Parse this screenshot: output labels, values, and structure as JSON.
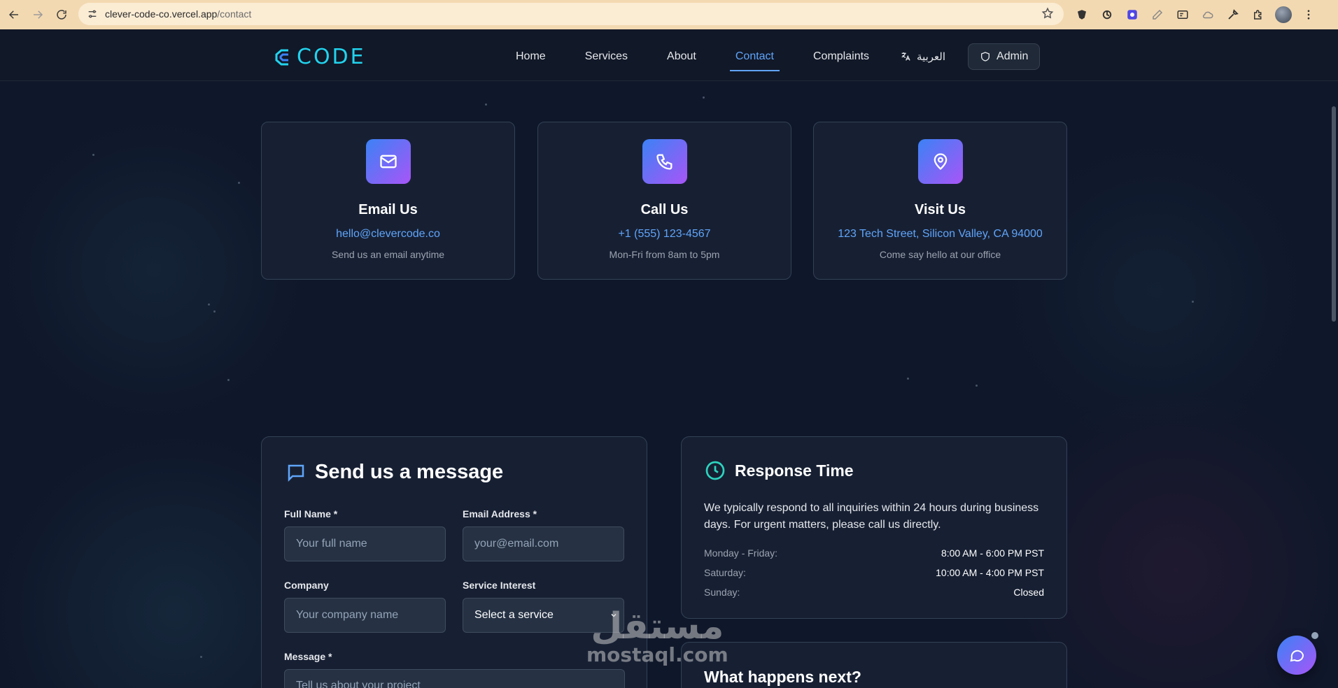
{
  "browser": {
    "url_host": "clever-code-co.vercel.app",
    "url_path": "/contact"
  },
  "header": {
    "logo_text": "CODE",
    "nav": [
      {
        "label": "Home"
      },
      {
        "label": "Services"
      },
      {
        "label": "About"
      },
      {
        "label": "Contact",
        "active": true
      },
      {
        "label": "Complaints"
      }
    ],
    "language_label": "العربية",
    "admin_label": "Admin"
  },
  "contact_cards": [
    {
      "icon": "mail-icon",
      "title": "Email Us",
      "value": "hello@clevercode.co",
      "subtitle": "Send us an email anytime"
    },
    {
      "icon": "phone-icon",
      "title": "Call Us",
      "value": "+1 (555) 123-4567",
      "subtitle": "Mon-Fri from 8am to 5pm"
    },
    {
      "icon": "map-pin-icon",
      "title": "Visit Us",
      "value": "123 Tech Street, Silicon Valley, CA 94000",
      "subtitle": "Come say hello at our office"
    }
  ],
  "form": {
    "title": "Send us a message",
    "full_name": {
      "label": "Full Name *",
      "placeholder": "Your full name"
    },
    "email": {
      "label": "Email Address *",
      "placeholder": "your@email.com"
    },
    "company": {
      "label": "Company",
      "placeholder": "Your company name"
    },
    "service": {
      "label": "Service Interest",
      "selected": "Select a service"
    },
    "message": {
      "label": "Message *",
      "placeholder": "Tell us about your project"
    }
  },
  "response": {
    "title": "Response Time",
    "text": "We typically respond to all inquiries within 24 hours during business days. For urgent matters, please call us directly.",
    "hours": [
      {
        "day": "Monday - Friday:",
        "time": "8:00 AM - 6:00 PM PST"
      },
      {
        "day": "Saturday:",
        "time": "10:00 AM - 4:00 PM PST"
      },
      {
        "day": "Sunday:",
        "time": "Closed"
      }
    ]
  },
  "next": {
    "title": "What happens next?"
  },
  "watermark": {
    "arabic": "مستقل",
    "latin": "mostaql.com"
  },
  "colors": {
    "accent": "#60a5fa",
    "brand_cyan": "#22d3ee",
    "gradient_start": "#3b82f6",
    "gradient_end": "#a855f7",
    "background": "#0f172a",
    "card": "#172033"
  }
}
